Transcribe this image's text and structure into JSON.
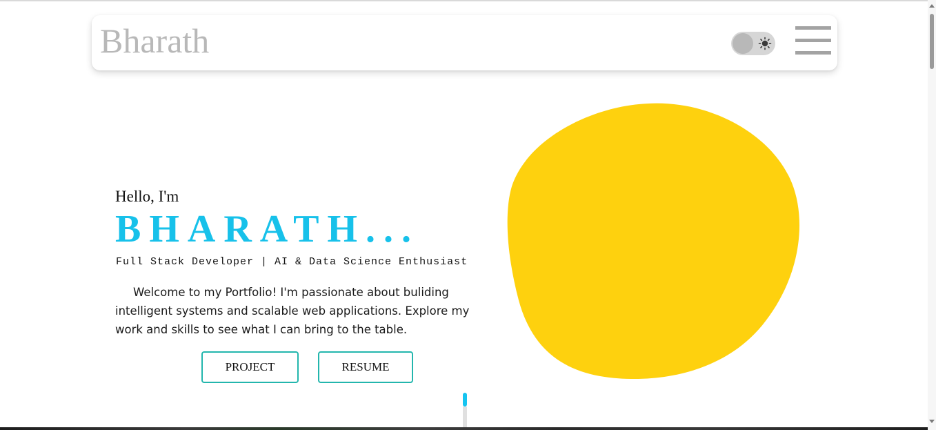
{
  "navbar": {
    "brand": "Bharath",
    "theme_toggle_icon": "sun-icon",
    "menu_icon": "hamburger-menu-icon"
  },
  "hero": {
    "greeting": "Hello, I'm",
    "name": "BHARATH...",
    "role": "Full Stack Developer | AI & Data Science Enthusiast",
    "intro": "Welcome to my Portfolio! I'm passionate about buliding intelligent systems and scalable web applications. Explore my work and skills to see what I can bring to the table.",
    "buttons": {
      "project": "PROJECT",
      "resume": "RESUME"
    }
  },
  "colors": {
    "accent": "#17c1ea",
    "blob": "#fed10e",
    "button_border": "#23b6ad",
    "brand_text": "#b8b8b8"
  }
}
